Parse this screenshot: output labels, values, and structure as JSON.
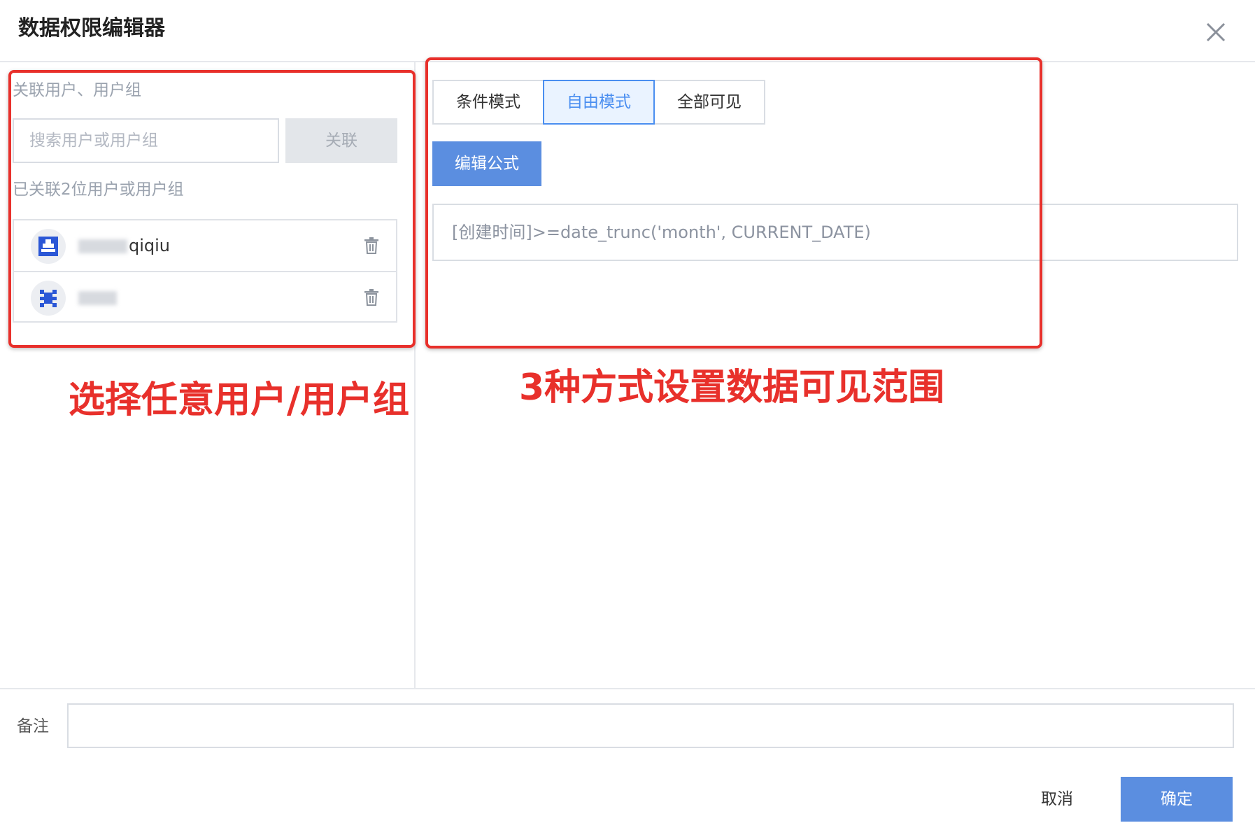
{
  "dialog": {
    "title": "数据权限编辑器",
    "close_icon": "close-icon"
  },
  "left": {
    "section_label": "关联用户、用户组",
    "search": {
      "placeholder": "搜索用户或用户组",
      "value": ""
    },
    "link_button": "关联",
    "linked_count_label": "已关联2位用户或用户组",
    "users": [
      {
        "name_suffix": "qiqiu",
        "avatar_icon": "user-avatar-icon",
        "delete_icon": "trash-icon"
      },
      {
        "name_suffix": "",
        "avatar_icon": "group-avatar-icon",
        "delete_icon": "trash-icon"
      }
    ]
  },
  "right": {
    "modes": [
      {
        "label": "条件模式",
        "active": false
      },
      {
        "label": "自由模式",
        "active": true
      },
      {
        "label": "全部可见",
        "active": false
      }
    ],
    "edit_formula_button": "编辑公式",
    "formula": "[创建时间]>=date_trunc('month', CURRENT_DATE)"
  },
  "annotations": {
    "left_caption": "选择任意用户/用户组",
    "right_caption": "3种方式设置数据可见范围",
    "color": "#e8302b"
  },
  "footer": {
    "remark_label": "备注",
    "remark_value": "",
    "cancel": "取消",
    "confirm": "确定"
  },
  "colors": {
    "primary": "#5b8ee0",
    "active_tab": "#4a8ef0",
    "border": "#d9dde3"
  }
}
